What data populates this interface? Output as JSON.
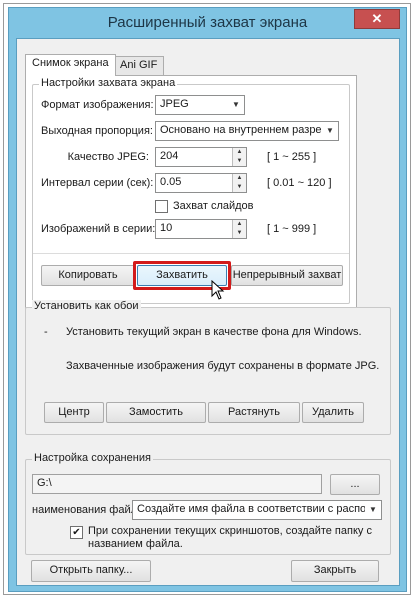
{
  "window": {
    "title": "Расширенный захват экрана",
    "close": "✕"
  },
  "tabs": [
    {
      "label": "Снимок экрана"
    },
    {
      "label": "Ani GIF"
    }
  ],
  "capture_settings": {
    "group_title": "Настройки захвата экрана",
    "format_label": "Формат изображения:",
    "format_value": "JPEG",
    "ratio_label": "Выходная пропорция:",
    "ratio_value": "Основано на внутреннем разрешении",
    "quality_label": "Качество JPEG:",
    "quality_value": "204",
    "quality_range": "[ 1 ~ 255 ]",
    "interval_label": "Интервал серии (сек):",
    "interval_value": "0.05",
    "interval_range": "[ 0.01 ~ 120 ]",
    "slides_label": "Захват слайдов",
    "slides_checked": false,
    "count_label": "Изображений в серии:",
    "count_value": "10",
    "count_range": "[ 1 ~ 999 ]"
  },
  "capture_buttons": {
    "copy": "Копировать",
    "capture": "Захватить",
    "continuous": "Непрерывный захват"
  },
  "wallpaper": {
    "group_title": "Установить как обои",
    "bullet": "-",
    "line1": "Установить текущий экран в качестве фона для Windows.",
    "line2": "Захваченные изображения будут сохранены в формате JPG.",
    "center": "Центр",
    "tile": "Замостить",
    "stretch": "Растянуть",
    "delete": "Удалить"
  },
  "save": {
    "group_title": "Настройка сохранения",
    "path": "G:\\",
    "browse": "...",
    "filename_label": "наименования файл:",
    "filename_value": "Создайте имя файла в соответствии с расположением",
    "folder_check_label_1": "При сохранении текущих скриншотов, создайте папку с",
    "folder_check_label_2": "названием файла.",
    "folder_check_checked": true
  },
  "footer": {
    "open_folder": "Открыть папку...",
    "close": "Закрыть"
  }
}
